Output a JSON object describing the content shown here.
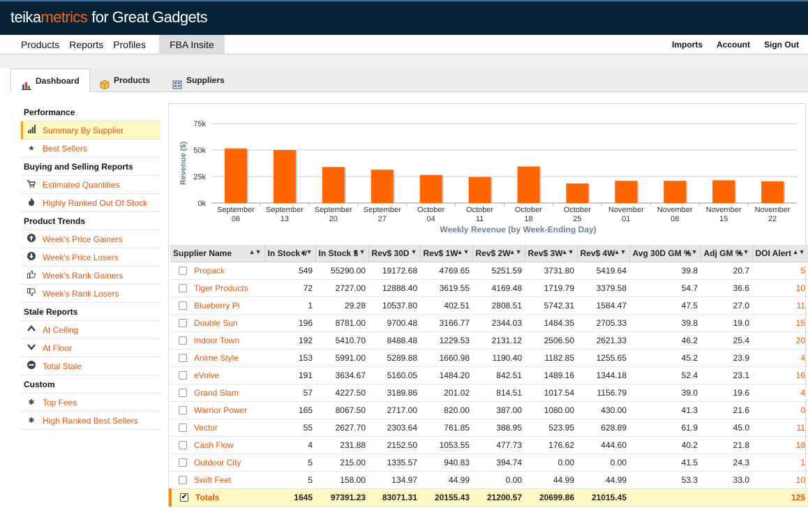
{
  "brand": {
    "part1": "teika",
    "part2": "metrics",
    "part3": "for Great Gadgets",
    "accent": "#f26a0f"
  },
  "mainnav": {
    "items": [
      "Products",
      "Reports",
      "Profiles",
      "FBA Insite"
    ],
    "right": [
      "Imports",
      "Account",
      "Sign Out"
    ]
  },
  "subtabs": [
    {
      "label": "Dashboard",
      "icon": "bar-chart-icon"
    },
    {
      "label": "Products",
      "icon": "box-icon"
    },
    {
      "label": "Suppliers",
      "icon": "building-icon"
    }
  ],
  "sidebar": {
    "performance": "Performance",
    "summary_by_supplier": "Summary By Supplier",
    "best_sellers": "Best Sellers",
    "buying_selling": "Buying and Selling Reports",
    "estimated_quantities": "Estimated Quantities",
    "highly_ranked_oos": "Highly Ranked Out Of Stock",
    "product_trends": "Product Trends",
    "price_gainers": "Week's Price Gainers",
    "price_losers": "Week's Price Losers",
    "rank_gainers": "Week's Rank Gainers",
    "rank_losers": "Week's Rank Losers",
    "stale_reports": "Stale Reports",
    "at_ceiling": "At Ceiling",
    "at_floor": "At Floor",
    "total_stale": "Total Stale",
    "custom": "Custom",
    "top_fees": "Top Fees",
    "high_ranked_best_sellers": "High Ranked Best Sellers"
  },
  "chart_data": {
    "type": "bar",
    "categories": [
      [
        "September",
        "06"
      ],
      [
        "September",
        "13"
      ],
      [
        "September",
        "20"
      ],
      [
        "September",
        "27"
      ],
      [
        "October",
        "04"
      ],
      [
        "October",
        "11"
      ],
      [
        "October",
        "18"
      ],
      [
        "October",
        "25"
      ],
      [
        "November",
        "01"
      ],
      [
        "November",
        "08"
      ],
      [
        "November",
        "15"
      ],
      [
        "November",
        "22"
      ]
    ],
    "values": [
      51500,
      50000,
      34000,
      31500,
      26500,
      24500,
      34500,
      18500,
      21000,
      21000,
      21500,
      20500
    ],
    "ylabel": "Revenue ($)",
    "xlabel": "Weekly Revenue (by Week-Ending Day)",
    "yticks": [
      "0k",
      "25k",
      "50k",
      "75k"
    ],
    "ylim": [
      0,
      75000
    ],
    "grid": true,
    "bar_color": "#ff6600"
  },
  "table": {
    "headers": [
      "Supplier Name",
      "In Stock #",
      "In Stock $",
      "Rev$ 30D",
      "Rev$ 1W",
      "Rev$ 2W",
      "Rev$ 3W",
      "Rev$ 4W",
      "Avg 30D GM %",
      "Adj GM %",
      "DOI Alert"
    ],
    "rows": [
      [
        "Propack",
        "549",
        "55290.00",
        "19172.68",
        "4769.65",
        "5251.59",
        "3731.80",
        "5419.64",
        "39.8",
        "20.7",
        "5"
      ],
      [
        "Tiger Products",
        "72",
        "2727.00",
        "12888.40",
        "3619.55",
        "4169.48",
        "1719.79",
        "3379.58",
        "54.7",
        "36.6",
        "10"
      ],
      [
        "Blueberry Pi",
        "1",
        "29.28",
        "10537.80",
        "402.51",
        "2808.51",
        "5742.31",
        "1584.47",
        "47.5",
        "27.0",
        "11"
      ],
      [
        "Double Sun",
        "196",
        "8781.00",
        "9700.48",
        "3166.77",
        "2344.03",
        "1484.35",
        "2705.33",
        "39.8",
        "19.0",
        "15"
      ],
      [
        "Indoor Town",
        "192",
        "5410.70",
        "8488.48",
        "1229.53",
        "2131.12",
        "2506.50",
        "2621.33",
        "46.2",
        "25.4",
        "20"
      ],
      [
        "Anime Style",
        "153",
        "5991.00",
        "5289.88",
        "1660.98",
        "1190.40",
        "1182.85",
        "1255.65",
        "45.2",
        "23.9",
        "4"
      ],
      [
        "eVolve",
        "191",
        "3634.67",
        "5160.05",
        "1484.20",
        "842.51",
        "1489.16",
        "1344.18",
        "52.4",
        "23.1",
        "16"
      ],
      [
        "Grand Slam",
        "57",
        "4227.50",
        "3189.86",
        "201.02",
        "814.51",
        "1017.54",
        "1156.79",
        "39.0",
        "19.6",
        "4"
      ],
      [
        "Warrior Power",
        "165",
        "8067.50",
        "2717.00",
        "820.00",
        "387.00",
        "1080.00",
        "430.00",
        "41.3",
        "21.6",
        "0"
      ],
      [
        "Vector",
        "55",
        "2627.70",
        "2303.64",
        "761.85",
        "388.95",
        "523.95",
        "628.89",
        "61.9",
        "45.0",
        "11"
      ],
      [
        "Cash Flow",
        "4",
        "231.88",
        "2152.50",
        "1053.55",
        "477.73",
        "176.62",
        "444.60",
        "40.2",
        "21.8",
        "18"
      ],
      [
        "Outdoor City",
        "5",
        "215.00",
        "1335.57",
        "940.83",
        "394.74",
        "0.00",
        "0.00",
        "41.5",
        "24.3",
        "1"
      ],
      [
        "Swift Feet",
        "5",
        "158.00",
        "134.97",
        "44.99",
        "0.00",
        "44.99",
        "44.99",
        "53.3",
        "33.0",
        "10"
      ]
    ],
    "totals": [
      "Totals",
      "1645",
      "97391.23",
      "83071.31",
      "20155.43",
      "21200.57",
      "20699.86",
      "21015.45",
      "",
      "",
      "125"
    ]
  }
}
